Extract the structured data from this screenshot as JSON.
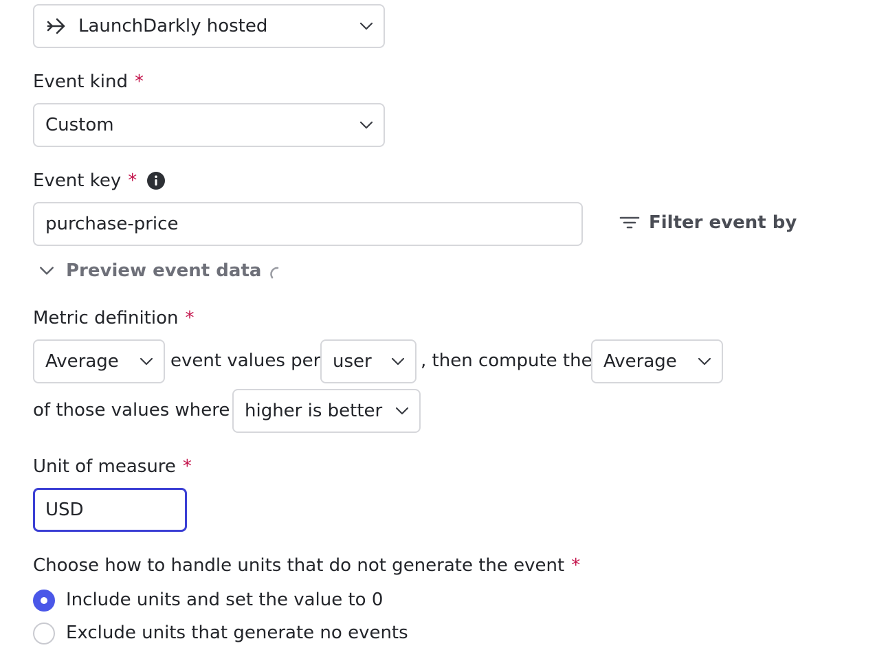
{
  "data_source": {
    "value": "LaunchDarkly hosted",
    "icon": "arrow-right-icon"
  },
  "event_kind": {
    "label": "Event kind",
    "required_mark": "*",
    "value": "Custom"
  },
  "event_key": {
    "label": "Event key",
    "required_mark": "*",
    "value": "purchase-price",
    "filter_label": "Filter event by"
  },
  "preview": {
    "label": "Preview event data"
  },
  "metric_definition": {
    "label": "Metric definition",
    "required_mark": "*",
    "aggregate_value": "Average",
    "text_1": "event values per",
    "unit_value": "user",
    "text_2": ", then compute the",
    "stat_value": "Average",
    "text_3": "of those values where",
    "direction_value": "higher is better"
  },
  "unit_of_measure": {
    "label": "Unit of measure",
    "required_mark": "*",
    "value": "USD"
  },
  "missing_units": {
    "label": "Choose how to handle units that do not generate the event",
    "required_mark": "*",
    "options": [
      {
        "label": "Include units and set the value to 0",
        "checked": true
      },
      {
        "label": "Exclude units that generate no events",
        "checked": false
      }
    ]
  },
  "colors": {
    "accent": "#4a57e8",
    "focus": "#3b3fd4",
    "required": "#c4164d",
    "border": "#d6d7db"
  }
}
